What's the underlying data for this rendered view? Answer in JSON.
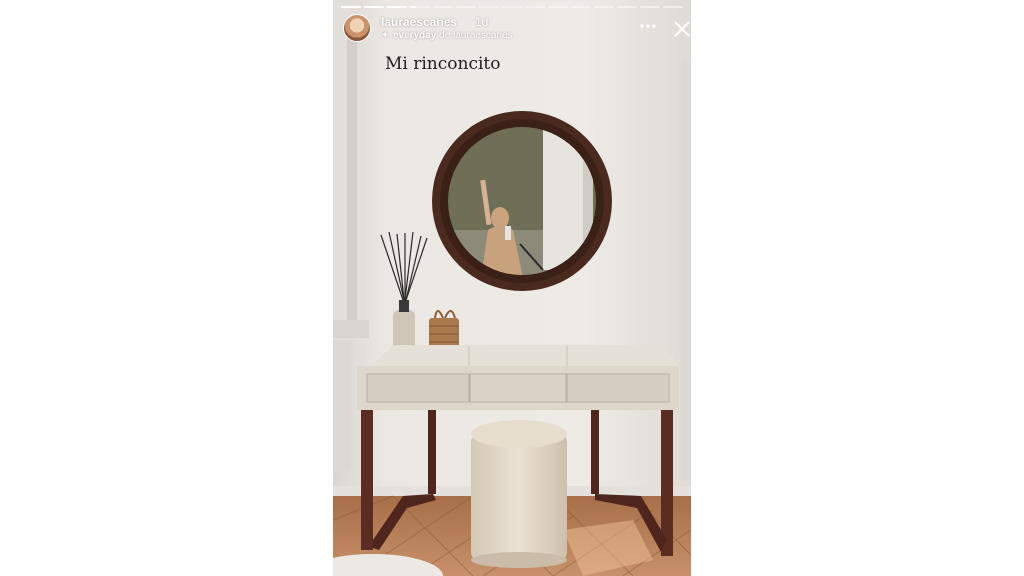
{
  "story": {
    "username": "lauraescanes",
    "time_ago": "1d",
    "highlight_name": "everyday",
    "highlight_prefix": "de",
    "highlight_owner": "lauraescanes",
    "caption": "Mi rinconcito",
    "progress": [
      1,
      1,
      1,
      0.3,
      0,
      0,
      0,
      0,
      0,
      0,
      0,
      0,
      0,
      0,
      0
    ]
  },
  "icons": {
    "avatar": "avatar",
    "sparkle": "sparkle-icon",
    "more": "more-options-icon",
    "close": "close-icon"
  },
  "colors": {
    "wall": "#e9e6e1",
    "mirror_frame": "#4a2a1e",
    "desk_top": "#e4dfd6",
    "desk_legs": "#5a2c22",
    "floor": "#b9825a",
    "stool": "#e0d6c6"
  }
}
